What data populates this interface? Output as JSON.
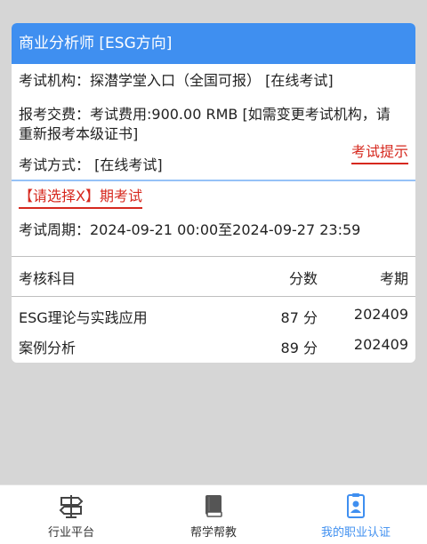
{
  "card": {
    "title": "商业分析师 [ESG方向]",
    "institution": "考试机构：探潜学堂入口（全国可报） [在线考试]",
    "fee": "报考交费：考试费用:900.00 RMB [如需变更考试机构，请重新报考本级证书]",
    "method": "考试方式： [在线考试]",
    "tip_link": "考试提示",
    "select_period": "【请选择X】期考试",
    "period": "考试周期：2024-09-21 00:00至2024-09-27 23:59"
  },
  "table": {
    "headers": {
      "subject": "考核科目",
      "score": "分数",
      "period": "考期"
    },
    "rows": [
      {
        "subject": "ESG理论与实践应用",
        "score": "87 分",
        "period": "202409"
      },
      {
        "subject": "案例分析",
        "score": "89 分",
        "period": "202409"
      }
    ]
  },
  "tabs": [
    {
      "label": "行业平台",
      "icon": "signpost-icon",
      "active": false
    },
    {
      "label": "帮学帮教",
      "icon": "book-icon",
      "active": false
    },
    {
      "label": "我的职业认证",
      "icon": "certificate-icon",
      "active": true
    }
  ],
  "colors": {
    "accent": "#3f8ff0",
    "warning": "#d6281e",
    "background": "#d6d6d6"
  }
}
